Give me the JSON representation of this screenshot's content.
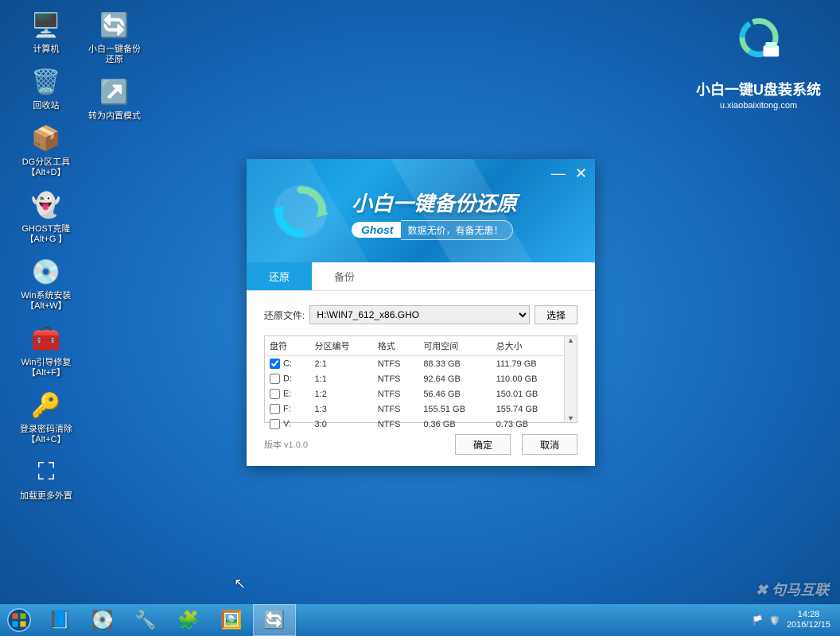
{
  "brand": {
    "title": "小白一键U盘装系统",
    "url": "u.xiaobaixitong.com"
  },
  "desktop_col1": [
    {
      "name": "computer",
      "label": "计算机",
      "glyph": "🖥️"
    },
    {
      "name": "recycle",
      "label": "回收站",
      "glyph": "🗑️"
    },
    {
      "name": "dg",
      "label": "DG分区工具\n【Alt+D】",
      "glyph": "📦"
    },
    {
      "name": "ghost",
      "label": "GHOST克隆\n【Alt+G 】",
      "glyph": "👻"
    },
    {
      "name": "winsetup",
      "label": "Win系统安装\n【Alt+W】",
      "glyph": "💿"
    },
    {
      "name": "bootfix",
      "label": "Win引导修复\n【Alt+F】",
      "glyph": "🧰"
    },
    {
      "name": "pwdclear",
      "label": "登录密码清除\n【Alt+C】",
      "glyph": "🔑"
    },
    {
      "name": "loadext",
      "label": "加载更多外置",
      "glyph": "⛶"
    }
  ],
  "desktop_col2": [
    {
      "name": "xiaobai",
      "label": "小白一键备份\n还原",
      "glyph": "🔄"
    },
    {
      "name": "builtin",
      "label": "转为内置模式",
      "glyph": "↗️"
    }
  ],
  "dialog": {
    "title": "小白一键备份还原",
    "ghost_label": "Ghost",
    "ghost_tag": "数据无价，有备无患！",
    "tabs": {
      "restore": "还原",
      "backup": "备份"
    },
    "file_label": "还原文件:",
    "file_value": "H:\\WIN7_612_x86.GHO",
    "browse": "选择",
    "columns": {
      "drive": "盘符",
      "part": "分区编号",
      "fs": "格式",
      "free": "可用空间",
      "total": "总大小"
    },
    "rows": [
      {
        "checked": true,
        "drive": "C:",
        "part": "2:1",
        "fs": "NTFS",
        "free": "88.33 GB",
        "total": "111.79 GB"
      },
      {
        "checked": false,
        "drive": "D:",
        "part": "1:1",
        "fs": "NTFS",
        "free": "92.64 GB",
        "total": "110.00 GB"
      },
      {
        "checked": false,
        "drive": "E:",
        "part": "1:2",
        "fs": "NTFS",
        "free": "56.46 GB",
        "total": "150.01 GB"
      },
      {
        "checked": false,
        "drive": "F:",
        "part": "1:3",
        "fs": "NTFS",
        "free": "155.51 GB",
        "total": "155.74 GB"
      },
      {
        "checked": false,
        "drive": "V:",
        "part": "3:0",
        "fs": "NTFS",
        "free": "0.36 GB",
        "total": "0.73 GB"
      }
    ],
    "version": "版本 v1.0.0",
    "ok": "确定",
    "cancel": "取消"
  },
  "taskbar": {
    "time": "14:28",
    "date": "2016/12/15"
  },
  "watermark": "✖ 句马互联"
}
